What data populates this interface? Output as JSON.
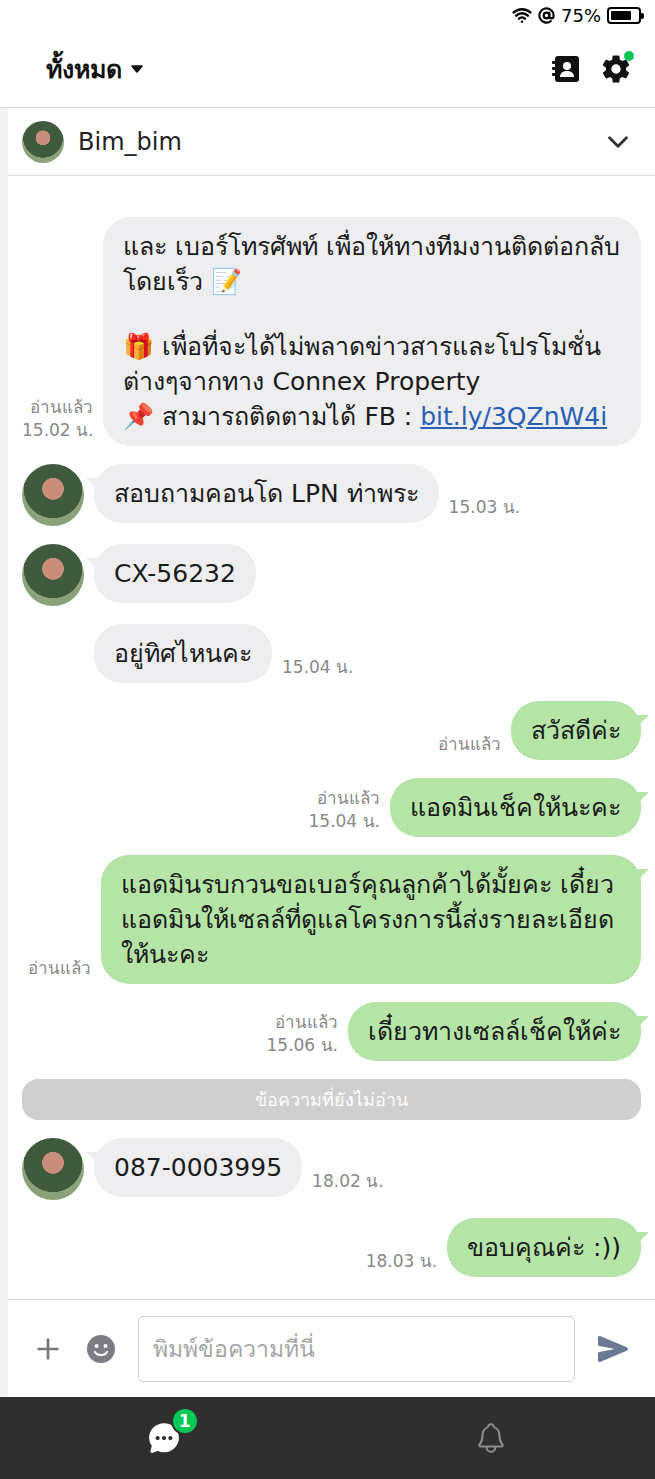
{
  "status_bar": {
    "battery": "75%",
    "battery_level": 0.75
  },
  "header": {
    "filter": "ทั้งหมด",
    "settings_dot": true
  },
  "chat": {
    "name": "Bim_bim"
  },
  "messages": [
    {
      "kind": "auto",
      "read": "อ่านแล้ว",
      "time": "15.02 น.",
      "paragraphs": [
        [
          [
            {
              "text": "และ เบอร์โทรศัพท์ เพื่อให้ทางทีมงานติดต่อกลับโดยเร็ว 📝",
              "link": false
            }
          ]
        ],
        [
          [
            {
              "text": "🎁 เพื่อที่จะได้ไม่พลาดข่าวสารและโปรโมชั่นต่างๆจากทาง Connex Property",
              "link": false
            }
          ],
          [
            {
              "text": "📌 สามารถติดตามได้ FB : ",
              "link": false
            },
            {
              "text": "bit.ly/3QZnW4i",
              "link": true
            }
          ]
        ]
      ]
    },
    {
      "kind": "incoming",
      "text": "สอบถามคอนโด LPN ท่าพระ",
      "time": "15.03 น.",
      "avatar": true
    },
    {
      "kind": "incoming",
      "text": "CX-56232",
      "time": "",
      "avatar": true
    },
    {
      "kind": "incoming",
      "text": "อยู่ทิศไหนคะ",
      "time": "15.04 น.",
      "avatar": false
    },
    {
      "kind": "outgoing",
      "text": "สวัสดีค่ะ",
      "read": "อ่านแล้ว",
      "time": ""
    },
    {
      "kind": "outgoing",
      "text": "แอดมินเช็คให้นะคะ",
      "read": "อ่านแล้ว",
      "time": "15.04 น."
    },
    {
      "kind": "outgoing",
      "text": "แอดมินรบกวนขอเบอร์คุณลูกค้าได้มั้ยคะ เดี๋ยวแอดมินให้เซลล์ที่ดูแลโครงการนี้ส่งรายละเอียดให้นะคะ",
      "read": "อ่านแล้ว",
      "time": ""
    },
    {
      "kind": "outgoing",
      "text": "เดี๋ยวทางเซลล์เช็คให้ค่ะ",
      "read": "อ่านแล้ว",
      "time": "15.06 น."
    },
    {
      "kind": "divider",
      "text": "ข้อความที่ยังไม่อ่าน"
    },
    {
      "kind": "incoming",
      "text": "087-0003995",
      "time": "18.02 น.",
      "avatar": true
    },
    {
      "kind": "outgoing",
      "text": "ขอบคุณค่ะ :))",
      "read": "",
      "time": "18.03 น."
    }
  ],
  "composer": {
    "placeholder": "พิมพ์ข้อความที่นี่"
  },
  "nav": [
    {
      "kind": "chat",
      "badge": "1",
      "selected": true
    },
    {
      "kind": "bell",
      "badge": "",
      "selected": false
    }
  ]
}
